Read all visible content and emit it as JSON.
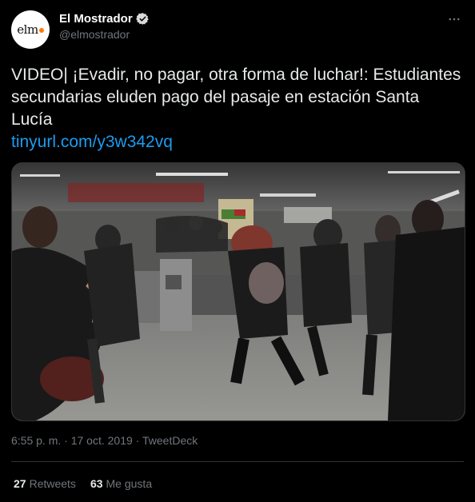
{
  "account": {
    "display_name": "El Mostrador",
    "handle": "@elmostrador",
    "avatar_text": "elm",
    "verified": true
  },
  "tweet": {
    "text": "VIDEO| ¡Evadir, no pagar, otra forma de luchar!: Estudiantes secundarias eluden pago del pasaje en estación Santa Lucía",
    "link": "tinyurl.com/y3w342vq",
    "time": "6:55 p. m.",
    "date": "17 oct. 2019",
    "separator": "·",
    "source": "TweetDeck"
  },
  "stats": {
    "retweets_count": "27",
    "retweets_label": "Retweets",
    "likes_count": "63",
    "likes_label": "Me gusta"
  },
  "icons": {
    "verified": "verified-badge-icon",
    "more": "more-options-icon"
  },
  "colors": {
    "background": "#000000",
    "link": "#1d9bf0",
    "muted": "#71767b",
    "text": "#e7e9ea",
    "avatar_accent": "#ff7a00"
  }
}
